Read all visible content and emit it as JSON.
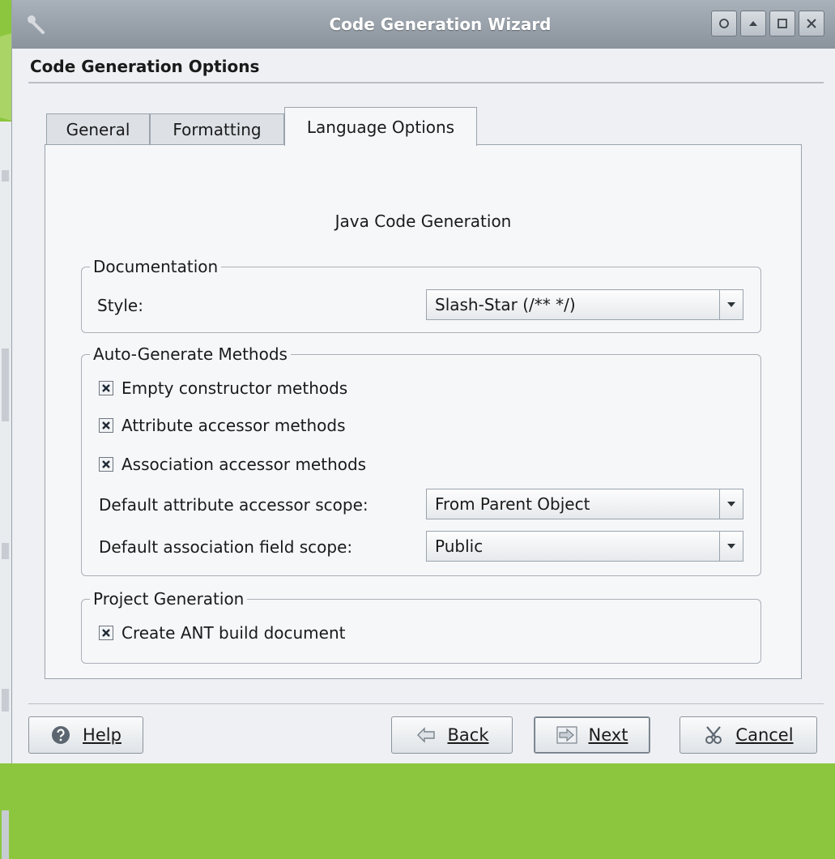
{
  "window": {
    "title": "Code Generation Wizard"
  },
  "header": {
    "title": "Code Generation Options"
  },
  "tabs": [
    {
      "label": "General",
      "active": false
    },
    {
      "label": "Formatting",
      "active": false
    },
    {
      "label": "Language Options",
      "active": true
    }
  ],
  "panel": {
    "title": "Java Code Generation",
    "documentation": {
      "legend": "Documentation",
      "style_label": "Style:",
      "style_value": "Slash-Star (/** */)"
    },
    "auto_generate": {
      "legend": "Auto-Generate Methods",
      "checks": [
        {
          "label": "Empty constructor methods",
          "checked": true
        },
        {
          "label": "Attribute accessor methods",
          "checked": true
        },
        {
          "label": "Association accessor methods",
          "checked": true
        }
      ],
      "attr_scope_label": "Default attribute accessor scope:",
      "attr_scope_value": "From Parent Object",
      "assoc_scope_label": "Default association field scope:",
      "assoc_scope_value": "Public"
    },
    "project": {
      "legend": "Project Generation",
      "check": {
        "label": "Create ANT build document",
        "checked": true
      }
    }
  },
  "buttons": {
    "help": "Help",
    "back": "Back",
    "next": "Next",
    "cancel": "Cancel"
  },
  "icons": {
    "titlebar": [
      "help-icon",
      "shade-icon",
      "maximize-icon",
      "close-icon"
    ],
    "checkbox_mark": "x-mark-icon"
  },
  "colors": {
    "desktop_bg": "#8cc63f",
    "window_bg": "#eef0f3",
    "titlebar": "#9aa2ab"
  }
}
